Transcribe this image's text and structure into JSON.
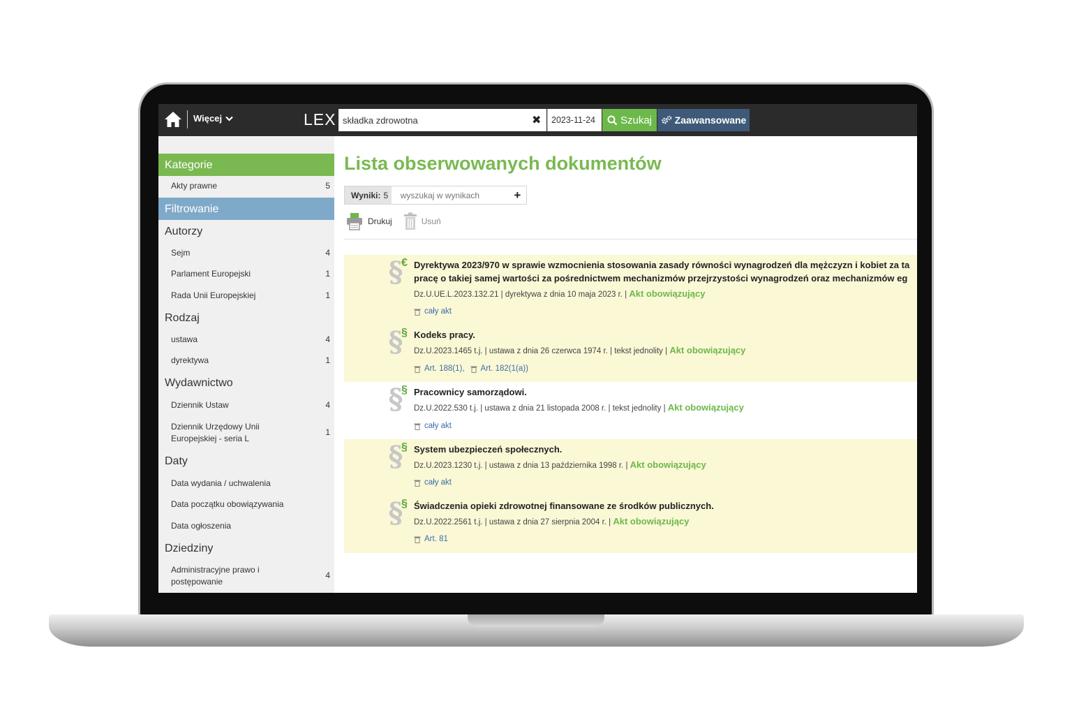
{
  "topbar": {
    "more_label": "Więcej",
    "logo": "LEX",
    "search_value": "składka zdrowotna",
    "date_value": "2023-11-24",
    "search_label": "Szukaj",
    "advanced_label": "Zaawansowane"
  },
  "sidebar": {
    "categories_header": "Kategorie",
    "categories": [
      {
        "label": "Akty prawne",
        "count": "5"
      }
    ],
    "filter_header": "Filtrowanie",
    "groups": {
      "authors": {
        "title": "Autorzy",
        "items": [
          {
            "label": "Sejm",
            "count": "4"
          },
          {
            "label": "Parlament Europejski",
            "count": "1"
          },
          {
            "label": "Rada Unii Europejskiej",
            "count": "1"
          }
        ]
      },
      "kinds": {
        "title": "Rodzaj",
        "items": [
          {
            "label": "ustawa",
            "count": "4"
          },
          {
            "label": "dyrektywa",
            "count": "1"
          }
        ]
      },
      "publishers": {
        "title": "Wydawnictwo",
        "items": [
          {
            "label": "Dziennik Ustaw",
            "count": "4"
          },
          {
            "label": "Dziennik Urzędowy Unii Europejskiej - seria L",
            "count": "1"
          }
        ]
      },
      "dates": {
        "title": "Daty",
        "items": [
          {
            "label": "Data wydania / uchwalenia"
          },
          {
            "label": "Data początku obowiązywania"
          },
          {
            "label": "Data ogłoszenia"
          }
        ]
      },
      "domains": {
        "title": "Dziedziny",
        "items": [
          {
            "label": "Administracyjne prawo i postępowanie",
            "count": "4"
          }
        ]
      }
    }
  },
  "main": {
    "title": "Lista obserwowanych dokumentów",
    "results_label": "Wyniki:",
    "results_count": "5",
    "results_search_placeholder": "wyszukaj w wynikach",
    "print_label": "Drukuj",
    "delete_label": "Usuń",
    "documents": [
      {
        "badge": "€",
        "title_line1": "Dyrektywa 2023/970 w sprawie wzmocnienia stosowania zasady równości wynagrodzeń dla mężczyzn i kobiet za ta",
        "title_line2": "pracę o takiej samej wartości za pośrednictwem mechanizmów przejrzystości wynagrodzeń oraz mechanizmów eg",
        "meta": "Dz.U.UE.L.2023.132.21 | dyrektywa z dnia 10 maja 2023 r. |",
        "status": "Akt obowiązujący",
        "links": [
          "cały akt"
        ]
      },
      {
        "badge": "§",
        "title_line1": "Kodeks pracy.",
        "meta": "Dz.U.2023.1465 t.j. | ustawa z dnia 26 czerwca 1974 r. | tekst jednolity |",
        "status": "Akt obowiązujący",
        "links": [
          "Art. 188(1),",
          "Art. 182(1(a))"
        ]
      },
      {
        "badge": "§",
        "title_line1": "Pracownicy samorządowi.",
        "meta": "Dz.U.2022.530 t.j. | ustawa z dnia 21 listopada 2008 r. | tekst jednolity |",
        "status": "Akt obowiązujący",
        "links": [
          "cały akt"
        ]
      },
      {
        "badge": "§",
        "title_line1": "System ubezpieczeń społecznych.",
        "meta": "Dz.U.2023.1230 t.j. | ustawa z dnia 13 października 1998 r. |",
        "status": "Akt obowiązujący",
        "links": [
          "cały akt"
        ]
      },
      {
        "badge": "§",
        "title_line1": "Świadczenia opieki zdrowotnej finansowane ze środków publicznych.",
        "meta": "Dz.U.2022.2561 t.j. | ustawa z dnia 27 sierpnia 2004 r. |",
        "status": "Akt obowiązujący",
        "links": [
          "Art. 81"
        ]
      }
    ]
  },
  "colors": {
    "accent_green": "#7ab952",
    "filter_blue": "#7fa9c9",
    "advanced_blue": "#3e5a78",
    "highlight_yellow": "#fbf8d6",
    "topbar": "#2b2b2b"
  }
}
